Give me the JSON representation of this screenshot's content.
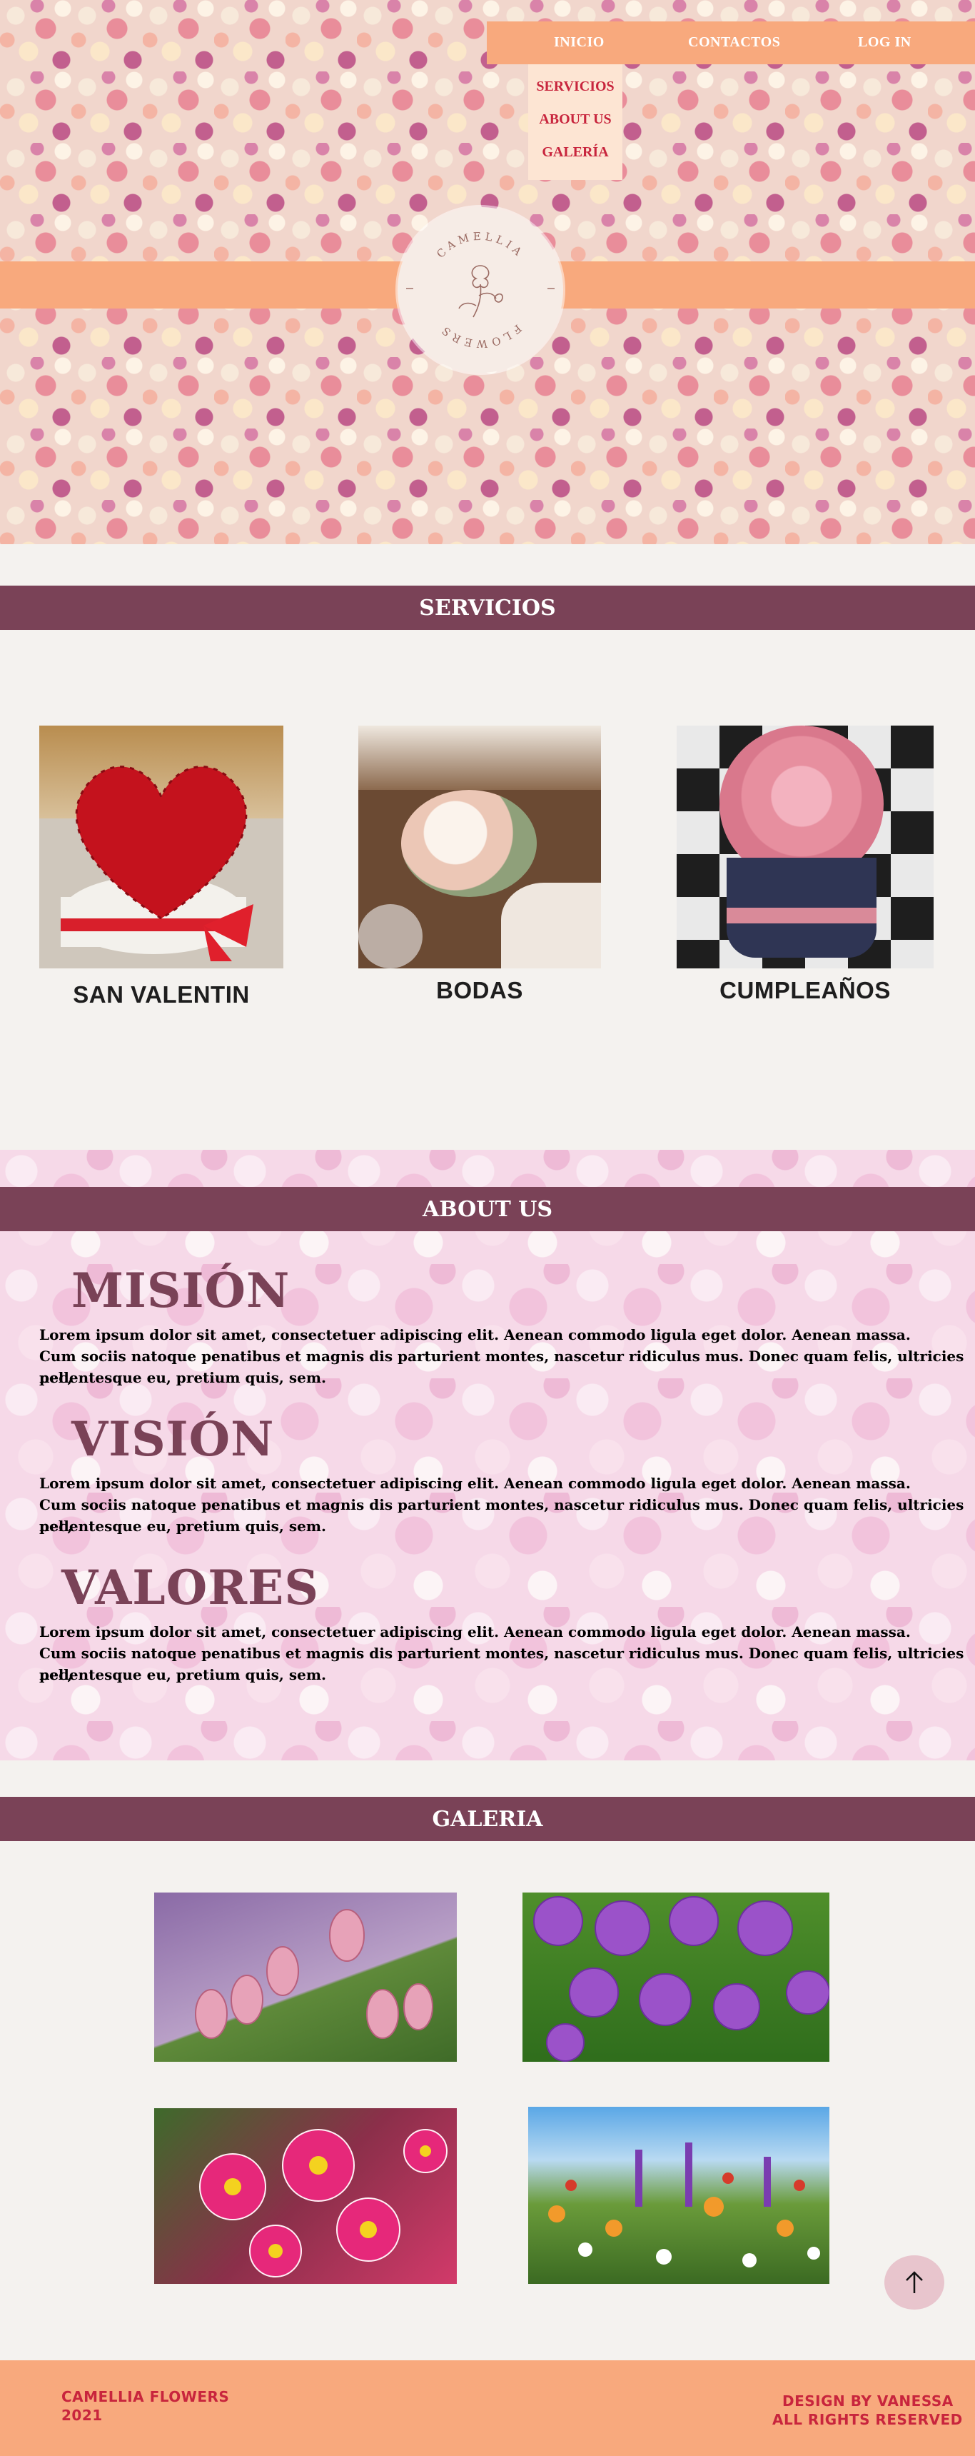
{
  "nav": {
    "inicio": "INICIO",
    "contactos": "CONTACTOS",
    "login": "LOG IN",
    "dropdown": [
      "SERVICIOS",
      "ABOUT US",
      "GALERÍA"
    ]
  },
  "logo": {
    "top_text": "CAMELLIA",
    "bottom_text": "FLOWERS",
    "icon": "flower-line-icon"
  },
  "servicios": {
    "title": "SERVICIOS",
    "items": [
      {
        "label": "SAN VALENTIN",
        "image": "red-rose-heart-arrangement"
      },
      {
        "label": "BODAS",
        "image": "wedding-table-flowers"
      },
      {
        "label": "CUMPLEAÑOS",
        "image": "pink-roses-box"
      }
    ]
  },
  "about": {
    "title": "ABOUT US",
    "blocks": [
      {
        "heading": "MISIÓN",
        "line1": "Lorem ipsum dolor sit amet, consectetuer adipiscing elit. Aenean commodo ligula eget dolor. Aenean massa.",
        "line2": "Cum sociis natoque penatibus et magnis dis parturient montes, nascetur ridiculus mus. Donec quam felis, ultricies nec,",
        "line3": "pellentesque eu, pretium quis, sem."
      },
      {
        "heading": "VISIÓN",
        "line1": "Lorem ipsum dolor sit amet, consectetuer adipiscing elit. Aenean commodo ligula eget dolor. Aenean massa.",
        "line2": "Cum sociis natoque penatibus et magnis dis parturient montes, nascetur ridiculus mus. Donec quam felis, ultricies nec,",
        "line3": "pellentesque eu, pretium quis, sem."
      },
      {
        "heading": "VALORES",
        "line1": "Lorem ipsum dolor sit amet, consectetuer adipiscing elit. Aenean commodo ligula eget dolor. Aenean massa.",
        "line2": "Cum sociis natoque penatibus et magnis dis parturient montes, nascetur ridiculus mus. Donec quam felis, ultricies nec,",
        "line3": "pellentesque eu, pretium quis, sem."
      }
    ]
  },
  "galeria": {
    "title": "GALERIA",
    "images": [
      "pink-tulips",
      "purple-alliums",
      "pink-daisies",
      "wildflower-meadow"
    ]
  },
  "back_to_top_icon": "arrow-up-icon",
  "footer": {
    "left_line1": "CAMELLIA FLOWERS",
    "left_line2": "2021",
    "right_line1": "DESIGN BY VANESSA",
    "right_line2": "ALL RIGHTS RESERVED"
  },
  "colors": {
    "peach": "#f8a97d",
    "plum": "#7a4257",
    "red_text": "#c8253d",
    "page_bg": "#f4f2ef"
  }
}
